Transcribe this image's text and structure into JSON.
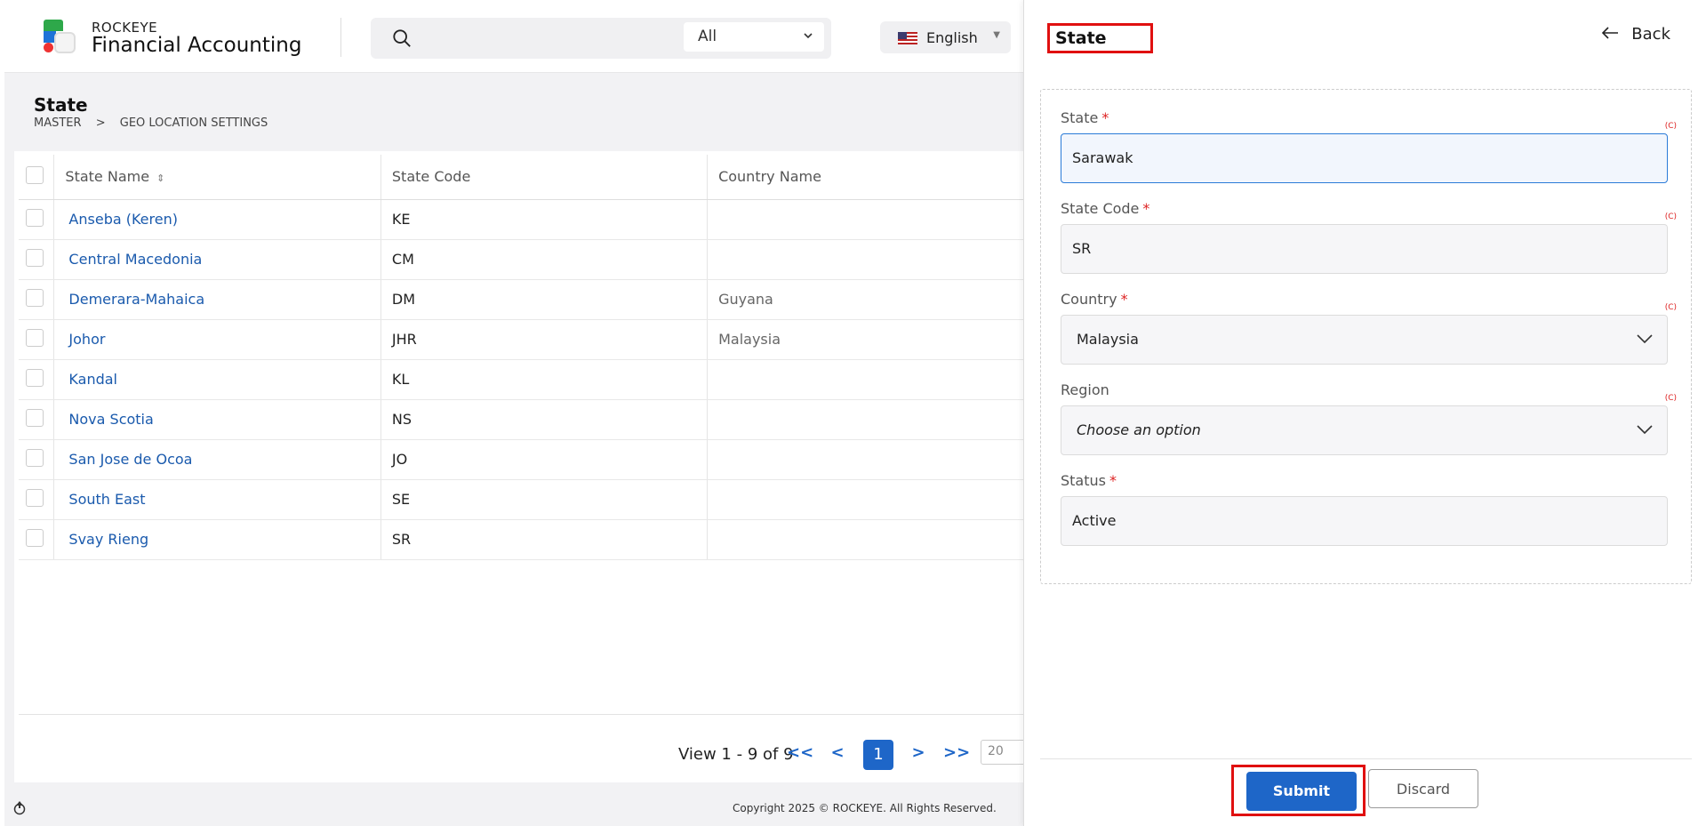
{
  "header": {
    "brand_small": "ROCKEYE",
    "brand_big": "Financial Accounting",
    "search_filter": "All",
    "language": "English"
  },
  "page": {
    "title": "State",
    "breadcrumb": [
      "MASTER",
      ">",
      "GEO LOCATION SETTINGS"
    ]
  },
  "table": {
    "columns": [
      "State Name",
      "State Code",
      "Country Name"
    ],
    "rows": [
      {
        "name": "Anseba (Keren)",
        "code": "KE",
        "country": ""
      },
      {
        "name": "Central Macedonia",
        "code": "CM",
        "country": ""
      },
      {
        "name": "Demerara-Mahaica",
        "code": "DM",
        "country": "Guyana"
      },
      {
        "name": "Johor",
        "code": "JHR",
        "country": "Malaysia"
      },
      {
        "name": "Kandal",
        "code": "KL",
        "country": ""
      },
      {
        "name": "Nova Scotia",
        "code": "NS",
        "country": ""
      },
      {
        "name": "San Jose de Ocoa",
        "code": "JO",
        "country": ""
      },
      {
        "name": "South East",
        "code": "SE",
        "country": ""
      },
      {
        "name": "Svay Rieng",
        "code": "SR",
        "country": ""
      }
    ]
  },
  "pager": {
    "info": "View 1 - 9 of 9",
    "first": "<<",
    "prev": "<",
    "current": "1",
    "next": ">",
    "last": ">>",
    "page_size": "20"
  },
  "footer": {
    "copyright": "Copyright 2025 © ROCKEYE. All Rights Reserved."
  },
  "drawer": {
    "title": "State",
    "back": "Back",
    "fields": {
      "state_label": "State",
      "state_value": "Sarawak",
      "state_code_label": "State Code",
      "state_code_value": "SR",
      "country_label": "Country",
      "country_value": "Malaysia",
      "region_label": "Region",
      "region_value": "Choose an option",
      "status_label": "Status",
      "status_value": "Active"
    },
    "required_mark": "*",
    "c_tag": "(C)",
    "submit": "Submit",
    "discard": "Discard"
  },
  "colors": {
    "accent": "#1e66c8",
    "highlight": "#e01010",
    "link": "#1a5aad"
  }
}
